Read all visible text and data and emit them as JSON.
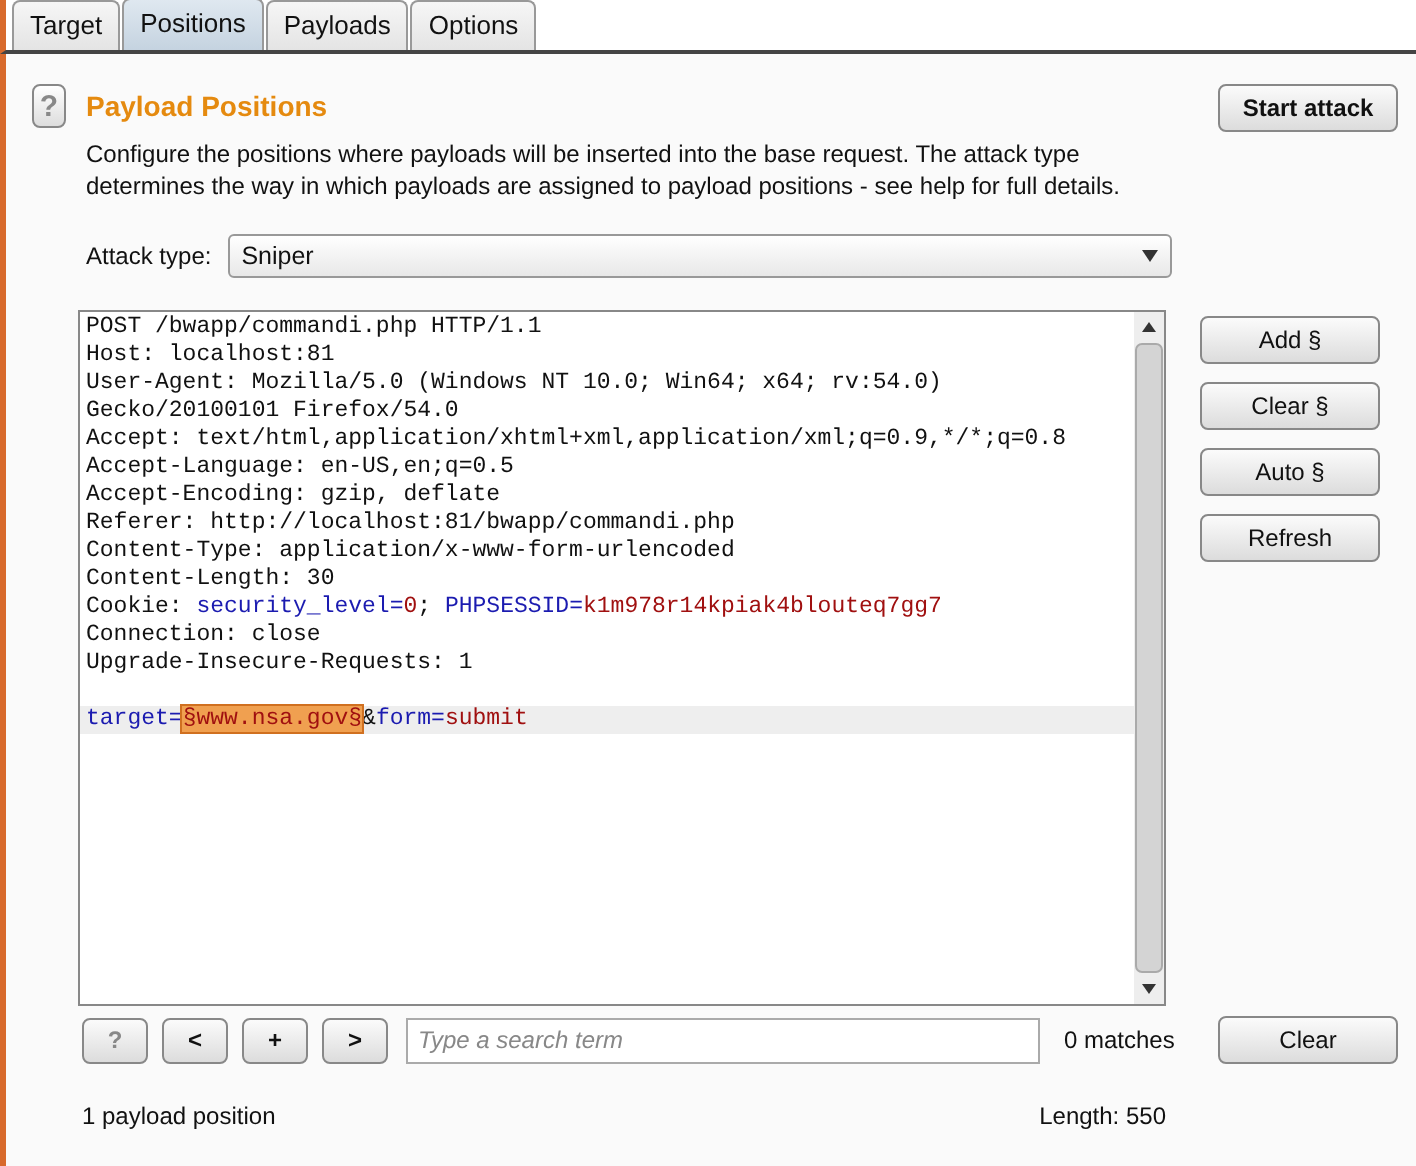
{
  "tabs": [
    {
      "label": "Target",
      "selected": false
    },
    {
      "label": "Positions",
      "selected": true
    },
    {
      "label": "Payloads",
      "selected": false
    },
    {
      "label": "Options",
      "selected": false
    }
  ],
  "panel": {
    "help_button": "?",
    "title": "Payload Positions",
    "description": "Configure the positions where payloads will be inserted into the base request. The attack type determines the way in which payloads are assigned to payload positions - see help for full details.",
    "start_button": "Start attack",
    "attack_type": {
      "label": "Attack type:",
      "value": "Sniper"
    },
    "editor": {
      "lines": [
        {
          "kind": "code",
          "highlighted": false,
          "segments": [
            {
              "kind": "text",
              "text": "POST /bwapp/commandi.php HTTP/1.1"
            }
          ]
        },
        {
          "kind": "code",
          "highlighted": false,
          "segments": [
            {
              "kind": "text",
              "text": "Host: localhost:81"
            }
          ]
        },
        {
          "kind": "code",
          "highlighted": false,
          "segments": [
            {
              "kind": "text",
              "text": "User-Agent: Mozilla/5.0 (Windows NT 10.0; Win64; x64; rv:54.0)"
            }
          ]
        },
        {
          "kind": "code",
          "highlighted": false,
          "segments": [
            {
              "kind": "text",
              "text": "Gecko/20100101 Firefox/54.0"
            }
          ]
        },
        {
          "kind": "code",
          "highlighted": false,
          "segments": [
            {
              "kind": "text",
              "text": "Accept: text/html,application/xhtml+xml,application/xml;q=0.9,*/*;q=0.8"
            }
          ]
        },
        {
          "kind": "code",
          "highlighted": false,
          "segments": [
            {
              "kind": "text",
              "text": "Accept-Language: en-US,en;q=0.5"
            }
          ]
        },
        {
          "kind": "code",
          "highlighted": false,
          "segments": [
            {
              "kind": "text",
              "text": "Accept-Encoding: gzip, deflate"
            }
          ]
        },
        {
          "kind": "code",
          "highlighted": false,
          "segments": [
            {
              "kind": "text",
              "text": "Referer: http://localhost:81/bwapp/commandi.php"
            }
          ]
        },
        {
          "kind": "code",
          "highlighted": false,
          "segments": [
            {
              "kind": "text",
              "text": "Content-Type: application/x-www-form-urlencoded"
            }
          ]
        },
        {
          "kind": "code",
          "highlighted": false,
          "segments": [
            {
              "kind": "text",
              "text": "Content-Length: 30"
            }
          ]
        },
        {
          "kind": "code",
          "highlighted": false,
          "segments": [
            {
              "kind": "text",
              "text": "Cookie: "
            },
            {
              "kind": "name",
              "text": "security_level="
            },
            {
              "kind": "value",
              "text": "0"
            },
            {
              "kind": "text",
              "text": "; "
            },
            {
              "kind": "name",
              "text": "PHPSESSID="
            },
            {
              "kind": "value",
              "text": "k1m978r14kpiak4blouteq7gg7"
            }
          ]
        },
        {
          "kind": "code",
          "highlighted": false,
          "segments": [
            {
              "kind": "text",
              "text": "Connection: close"
            }
          ]
        },
        {
          "kind": "code",
          "highlighted": false,
          "segments": [
            {
              "kind": "text",
              "text": "Upgrade-Insecure-Requests: 1"
            }
          ]
        },
        {
          "kind": "blank"
        },
        {
          "kind": "code",
          "highlighted": true,
          "segments": [
            {
              "kind": "name",
              "text": "target="
            },
            {
              "kind": "payload",
              "text": "§www.nsa.gov§"
            },
            {
              "kind": "text",
              "text": "&"
            },
            {
              "kind": "name",
              "text": "form="
            },
            {
              "kind": "value",
              "text": "submit"
            }
          ]
        }
      ]
    },
    "side_buttons": [
      "Add §",
      "Clear §",
      "Auto §",
      "Refresh"
    ],
    "search": {
      "buttons": [
        "?",
        "<",
        "+",
        ">"
      ],
      "placeholder": "Type a search term",
      "matches": "0 matches",
      "clear_button": "Clear"
    },
    "footer": {
      "positions": "1 payload position",
      "length": "Length: 550"
    }
  }
}
